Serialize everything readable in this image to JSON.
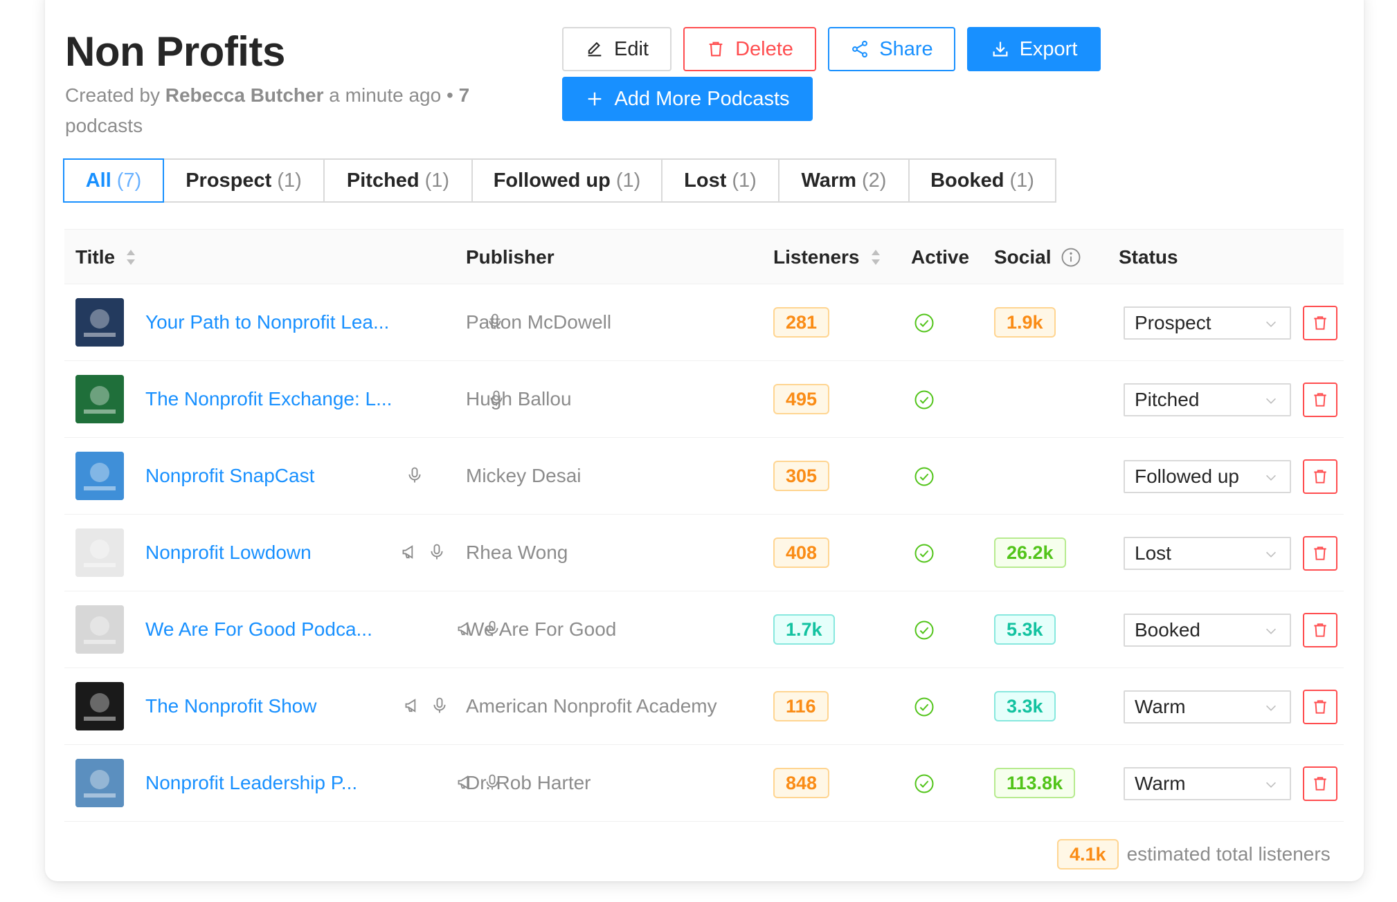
{
  "header": {
    "title": "Non Profits",
    "created_prefix": "Created by",
    "author": "Rebecca Butcher",
    "time": "a minute ago",
    "separator": "•",
    "count": "7",
    "count_suffix": "podcasts"
  },
  "actions": {
    "edit": "Edit",
    "delete": "Delete",
    "share": "Share",
    "export": "Export",
    "add": "Add More Podcasts"
  },
  "tabs": [
    {
      "label": "All",
      "count": "(7)",
      "active": true
    },
    {
      "label": "Prospect",
      "count": "(1)"
    },
    {
      "label": "Pitched",
      "count": "(1)"
    },
    {
      "label": "Followed up",
      "count": "(1)"
    },
    {
      "label": "Lost",
      "count": "(1)"
    },
    {
      "label": "Warm",
      "count": "(2)"
    },
    {
      "label": "Booked",
      "count": "(1)"
    }
  ],
  "columns": {
    "title": "Title",
    "publisher": "Publisher",
    "listeners": "Listeners",
    "active": "Active",
    "social": "Social",
    "status": "Status"
  },
  "rows": [
    {
      "title": "Your Path to Nonprofit Lea...",
      "publisher": "Patton McDowell",
      "listeners": "281",
      "listeners_color": "orange",
      "social": "1.9k",
      "social_color": "orange",
      "status": "Prospect",
      "media": [
        "mic-icon"
      ],
      "cover_color": "#233a5e"
    },
    {
      "title": "The Nonprofit Exchange: L...",
      "publisher": "Hugh Ballou",
      "listeners": "495",
      "listeners_color": "orange",
      "social": "",
      "social_color": "",
      "status": "Pitched",
      "media": [
        "mic-icon"
      ],
      "cover_color": "#1f6f3a"
    },
    {
      "title": "Nonprofit SnapCast",
      "publisher": "Mickey Desai",
      "listeners": "305",
      "listeners_color": "orange",
      "social": "",
      "social_color": "",
      "status": "Followed up",
      "media": [
        "mic-icon"
      ],
      "cover_color": "#3f8fd8"
    },
    {
      "title": "Nonprofit Lowdown",
      "publisher": "Rhea Wong",
      "listeners": "408",
      "listeners_color": "orange",
      "social": "26.2k",
      "social_color": "green",
      "status": "Lost",
      "media": [
        "megaphone-icon",
        "mic-icon"
      ],
      "cover_color": "#e8e8e8"
    },
    {
      "title": "We Are For Good Podca...",
      "publisher": "We Are For Good",
      "listeners": "1.7k",
      "listeners_color": "cyan",
      "social": "5.3k",
      "social_color": "cyan",
      "status": "Booked",
      "media": [
        "megaphone-icon",
        "mic-icon"
      ],
      "cover_color": "#d7d7d7"
    },
    {
      "title": "The Nonprofit Show",
      "publisher": "American Nonprofit Academy",
      "listeners": "116",
      "listeners_color": "orange",
      "social": "3.3k",
      "social_color": "cyan",
      "status": "Warm",
      "media": [
        "megaphone-icon",
        "mic-icon"
      ],
      "cover_color": "#1a1a1a"
    },
    {
      "title": "Nonprofit Leadership P...",
      "publisher": "Dr. Rob Harter",
      "listeners": "848",
      "listeners_color": "orange",
      "social": "113.8k",
      "social_color": "green",
      "status": "Warm",
      "media": [
        "megaphone-icon",
        "mic-icon"
      ],
      "cover_color": "#5b8fbf"
    }
  ],
  "footer": {
    "total": "4.1k",
    "label": "estimated total listeners"
  },
  "colors": {
    "primary": "#1890ff",
    "danger": "#ff4d4f",
    "success": "#52c41a",
    "orange": "#fa8c16"
  }
}
